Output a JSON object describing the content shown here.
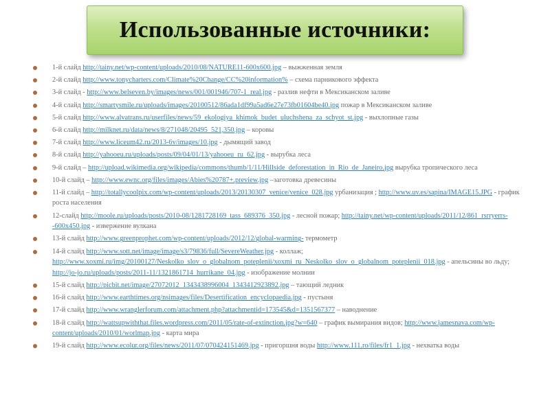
{
  "title": "Использованные источники:",
  "colors": {
    "title_bg": "#bfe08e",
    "link": "#2d7ec6",
    "text": "#6b6b6b",
    "bullet": "#b06a3a"
  },
  "items": [
    [
      {
        "t": "text",
        "v": "1-й слайд "
      },
      {
        "t": "link",
        "v": "http://tainy.net/wp-content/uploads/2010/08/NATURE11-600x600.jpg"
      },
      {
        "t": "text",
        "v": " – выжженная земля"
      }
    ],
    [
      {
        "t": "text",
        "v": "2-й слайд "
      },
      {
        "t": "link",
        "v": "http://www.tonycharters.com/Climate%20Change/CC%20information%"
      },
      {
        "t": "text",
        "v": "  – схема парникового эффекта"
      }
    ],
    [
      {
        "t": "text",
        "v": "3-й слайд - "
      },
      {
        "t": "link",
        "v": "http://www.belseven.by/images/news/001/001946/707-1_real.jpg"
      },
      {
        "t": "text",
        "v": " - разлив нефти в Мексиканском заливе"
      }
    ],
    [
      {
        "t": "text",
        "v": "4-й слайд "
      },
      {
        "t": "link",
        "v": "http://smartysmile.ru/uploads/images/20100512/86ada1df99a5ad6e27e73fb01604be40.jpg"
      },
      {
        "t": "text",
        "v": "  пожар в Мексиканском заливе"
      }
    ],
    [
      {
        "t": "text",
        "v": "5-й слайд "
      },
      {
        "t": "link",
        "v": "http://www.alvatrans.ru/userfiles/news/59_ekologiya_khimok_budet_uluchshena_za_schyot_st.jpg"
      },
      {
        "t": "text",
        "v": " - выхлопные газы"
      }
    ],
    [
      {
        "t": "text",
        "v": "6-й слайд "
      },
      {
        "t": "link",
        "v": "http://milknet.ru/data/news/8/271048/20495_521,350.jpg"
      },
      {
        "t": "text",
        "v": "  – коровы"
      }
    ],
    [
      {
        "t": "text",
        "v": "7-й слайд "
      },
      {
        "t": "link",
        "v": "http://www.liceum42.ru/2013-6v/images/10.jpg"
      },
      {
        "t": "text",
        "v": "   - дымящий завод"
      }
    ],
    [
      {
        "t": "text",
        "v": "8-й слайд "
      },
      {
        "t": "link",
        "v": "http://yahooeu.ru/uploads/posts/09/04/01/13/yahooeu_ru_62.jpg"
      },
      {
        "t": "text",
        "v": "  - вырубка леса"
      }
    ],
    [
      {
        "t": "text",
        "v": "9-й слайд – "
      },
      {
        "t": "link",
        "v": "http://upload.wikimedia.org/wikipedia/commons/thumb/1/11/Hillside_deforestation_in_Rio_de_Janeiro.jpg"
      },
      {
        "t": "text",
        "v": " вырубка тропического леса"
      }
    ],
    [
      {
        "t": "text",
        "v": "10-й слайд – "
      },
      {
        "t": "link",
        "v": "http://www.ewnc.org/files/images/Abies%20787+.preview.jpg"
      },
      {
        "t": "text",
        "v": " –заготовка  древесины"
      }
    ],
    [
      {
        "t": "text",
        "v": "11-й слайд – "
      },
      {
        "t": "link",
        "v": "http://totallycoolpix.com/wp-content/uploads/2013/20130307_venice/venice_028.jpg"
      },
      {
        "t": "text",
        "v": "  урбанизация ; "
      },
      {
        "t": "link",
        "v": "http://www.uv.es/sapina/IMAGE15.JPG"
      },
      {
        "t": "text",
        "v": "  - график роста населения"
      }
    ],
    [
      {
        "t": "text",
        "v": "12-слайд "
      },
      {
        "t": "link",
        "v": "http://moole.ru/uploads/posts/2010-08/1281728169_tass_689376_350.jpg"
      },
      {
        "t": "text",
        "v": "  - лесной пожар; "
      },
      {
        "t": "link",
        "v": "http://tainy.net/wp-content/uploads/2011/12/861_rsrryerrs--600x450.jpg"
      },
      {
        "t": "text",
        "v": "  - извержение вулкана"
      }
    ],
    [
      {
        "t": "text",
        "v": "13-й слайд "
      },
      {
        "t": "link",
        "v": "http://www.greenprophet.com/wp-content/uploads/2012/12/global-warming-"
      },
      {
        "t": "text",
        "v": "  термометр"
      }
    ],
    [
      {
        "t": "text",
        "v": "14-й слайд "
      },
      {
        "t": "link",
        "v": "http://www.sott.net/image/image/s3/79836/full/SevereWeather.jpg"
      },
      {
        "t": "text",
        "v": "  - коллаж; "
      },
      {
        "t": "link",
        "v": "http://www.xoxmi.ru/img/20100127/Neskolko_slov_o_globalnom_poteplenii/xoxmi_ru_Neskolko_slov_o_globalnom_poteplenii_018.jpg"
      },
      {
        "t": "text",
        "v": "  - апельсины во льду; "
      },
      {
        "t": "link",
        "v": "http://jo-jo.ru/uploads/posts/2011-11/1321861714_hurrikane_04.jpg"
      },
      {
        "t": "text",
        "v": "   -  изображение молнии"
      }
    ],
    [
      {
        "t": "text",
        "v": "15-й слайд "
      },
      {
        "t": "link",
        "v": "http://picbit.net/image/27072012_1343438996004_1343412923892.jpg"
      },
      {
        "t": "text",
        "v": " – тающий ледник"
      }
    ],
    [
      {
        "t": "text",
        "v": "16-й слайд "
      },
      {
        "t": "link",
        "v": "http://www.earthtimes.org/nsimages/files/Desertification_encyclopaedia.jpg"
      },
      {
        "t": "text",
        "v": "  - пустыня"
      }
    ],
    [
      {
        "t": "text",
        "v": "17-й слайд "
      },
      {
        "t": "link",
        "v": "http://www.wranglerforum.com/attachment.php?attachmentid=173545&d=1351567377"
      },
      {
        "t": "text",
        "v": " – наводнение"
      }
    ],
    [
      {
        "t": "text",
        "v": "18-й слайд "
      },
      {
        "t": "link",
        "v": "http://wattsupwiththat.files.wordpress.com/2011/05/rate-of-extinction.jpg?w=640"
      },
      {
        "t": "text",
        "v": "  – график вымирания видов; "
      },
      {
        "t": "link",
        "v": "http://www.jamesnava.com/wp-content/uploads/2010/01/worlmap.jpg"
      },
      {
        "t": "text",
        "v": " - карта мира"
      }
    ],
    [
      {
        "t": "text",
        "v": "19-й слайд "
      },
      {
        "t": "link",
        "v": "http://www.ecolur.org/files/news/2011/07/070424151469.jpg"
      },
      {
        "t": "text",
        "v": " - пригоршня воды "
      },
      {
        "t": "link",
        "v": "http://www.111.ro/files/fr1_1.jpg"
      },
      {
        "t": "text",
        "v": "  - нехватка воды"
      }
    ]
  ]
}
